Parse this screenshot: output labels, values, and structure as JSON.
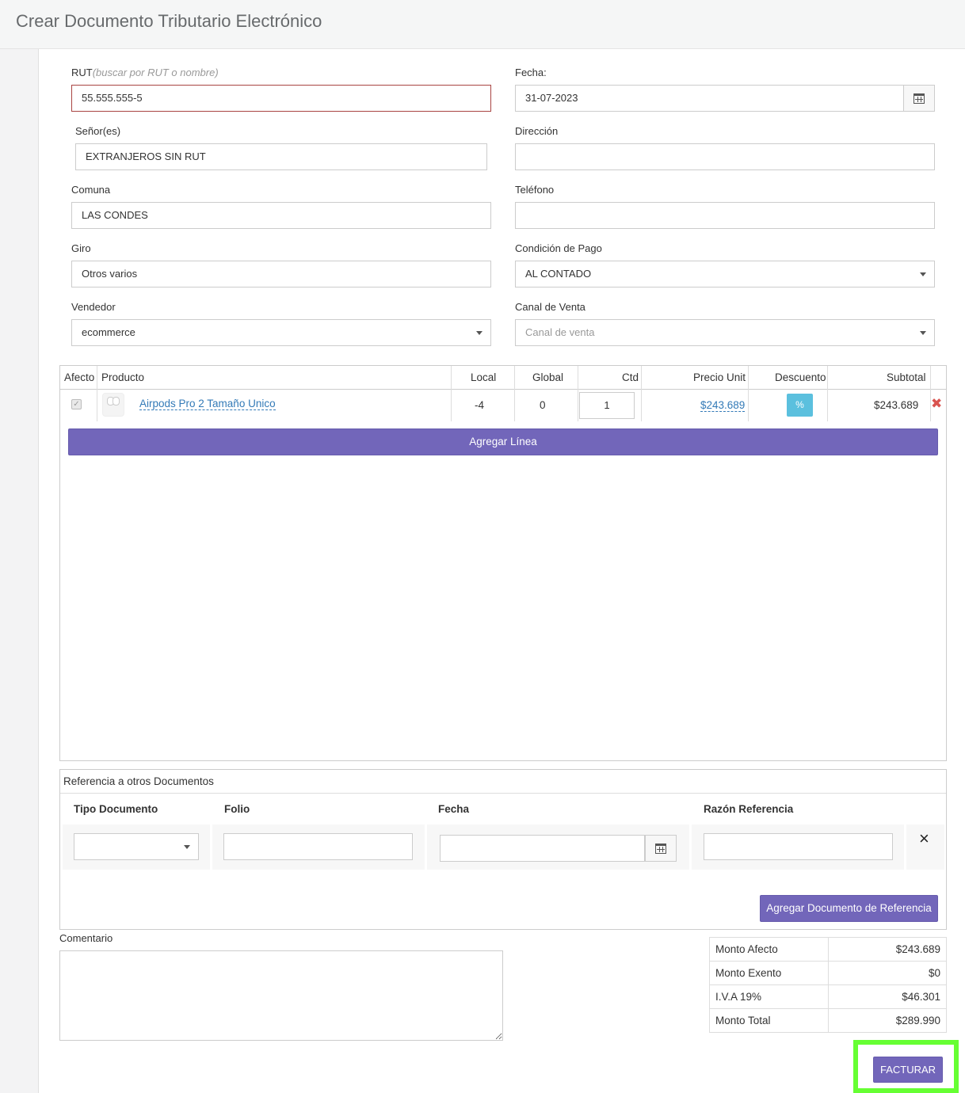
{
  "page": {
    "title": "Crear Documento Tributario Electrónico"
  },
  "form": {
    "rut_label": "RUT",
    "rut_hint": "(buscar por RUT o nombre)",
    "rut_value": "55.555.555-5",
    "fecha_label": "Fecha:",
    "fecha_value": "31-07-2023",
    "senores_label": "Señor(es)",
    "senores_value": "EXTRANJEROS SIN RUT",
    "direccion_label": "Dirección",
    "direccion_value": "",
    "comuna_label": "Comuna",
    "comuna_value": "LAS CONDES",
    "telefono_label": "Teléfono",
    "telefono_value": "",
    "giro_label": "Giro",
    "giro_value": "Otros varios",
    "condicion_label": "Condición de Pago",
    "condicion_value": "AL CONTADO",
    "vendedor_label": "Vendedor",
    "vendedor_value": "ecommerce",
    "canal_label": "Canal de Venta",
    "canal_placeholder": "Canal de venta"
  },
  "products": {
    "headers": {
      "afecto": "Afecto",
      "producto": "Producto",
      "local": "Local",
      "global": "Global",
      "ctd": "Ctd",
      "precio": "Precio Unit",
      "descuento": "Descuento",
      "subtotal": "Subtotal"
    },
    "rows": [
      {
        "afecto": true,
        "image_icon": "airpods-thumbnail",
        "product": "Airpods Pro 2 Tamaño Unico",
        "local": "-4",
        "global": "0",
        "ctd": "1",
        "precio": "$243.689",
        "descuento": "%",
        "subtotal": "$243.689"
      }
    ],
    "add_line_label": "Agregar Línea"
  },
  "references": {
    "title": "Referencia a otros Documentos",
    "headers": {
      "tipo": "Tipo Documento",
      "folio": "Folio",
      "fecha": "Fecha",
      "razon": "Razón Referencia"
    },
    "add_button": "Agregar Documento de Referencia",
    "remove_symbol": "×"
  },
  "comment": {
    "label": "Comentario",
    "value": ""
  },
  "totals": [
    {
      "label": "Monto Afecto",
      "value": "$243.689"
    },
    {
      "label": "Monto Exento",
      "value": "$0"
    },
    {
      "label": "I.V.A 19%",
      "value": "$46.301"
    },
    {
      "label": "Monto Total",
      "value": "$289.990"
    }
  ],
  "actions": {
    "submit_label": "FACTURAR"
  },
  "colors": {
    "accent": "#7266ba",
    "info": "#5bc0de",
    "danger": "#d9534f",
    "highlight": "#66ff33"
  }
}
